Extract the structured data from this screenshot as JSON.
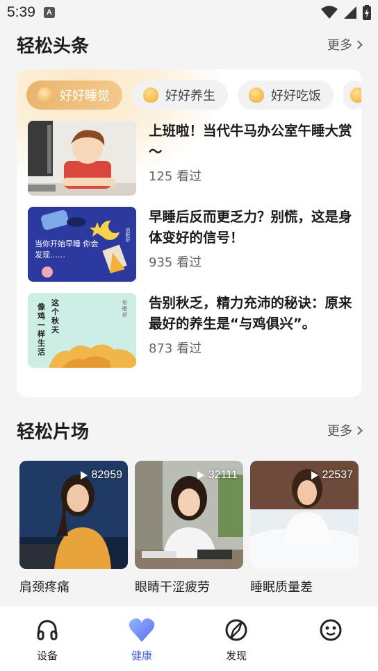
{
  "status_bar": {
    "time": "5:39",
    "notification_icon": "A"
  },
  "headlines": {
    "title": "轻松头条",
    "more_label": "更多",
    "tabs": [
      {
        "label": "好好睡觉",
        "active": true
      },
      {
        "label": "好好养生",
        "active": false
      },
      {
        "label": "好好吃饭",
        "active": false
      }
    ],
    "articles": [
      {
        "title": "上班啦！当代牛马办公室午睡大赏～",
        "views": "125 看过"
      },
      {
        "title": "早睡后反而更乏力？别慌，这是身体变好的信号！",
        "views": "935 看过",
        "thumb_text": "当你开始早睡 你会发现……",
        "thumb_brand": "倍眠舒"
      },
      {
        "title": "告别秋乏，精力充沛的秘诀：原来最好的养生是“与鸡俱兴”。",
        "views": "873 看过",
        "thumb_text_a": "这个秋天",
        "thumb_text_b": "像鸡一样生活",
        "thumb_brand": "倍眠舒"
      }
    ]
  },
  "videos": {
    "title": "轻松片场",
    "more_label": "更多",
    "items": [
      {
        "label": "肩颈疼痛",
        "plays": "82959"
      },
      {
        "label": "眼睛干涩疲劳",
        "plays": "32111"
      },
      {
        "label": "睡眠质量差",
        "plays": "22537"
      }
    ]
  },
  "bottom_nav": {
    "items": [
      {
        "label": "设备",
        "icon": "headphones-icon",
        "active": false
      },
      {
        "label": "健康",
        "icon": "heart-icon",
        "active": true
      },
      {
        "label": "发现",
        "icon": "compass-icon",
        "active": false
      },
      {
        "label": "",
        "icon": "smiley-icon",
        "active": false
      }
    ]
  },
  "colors": {
    "accent": "#4a5fd6",
    "tab_active": "#eeb975",
    "background": "#f4f4f5"
  }
}
